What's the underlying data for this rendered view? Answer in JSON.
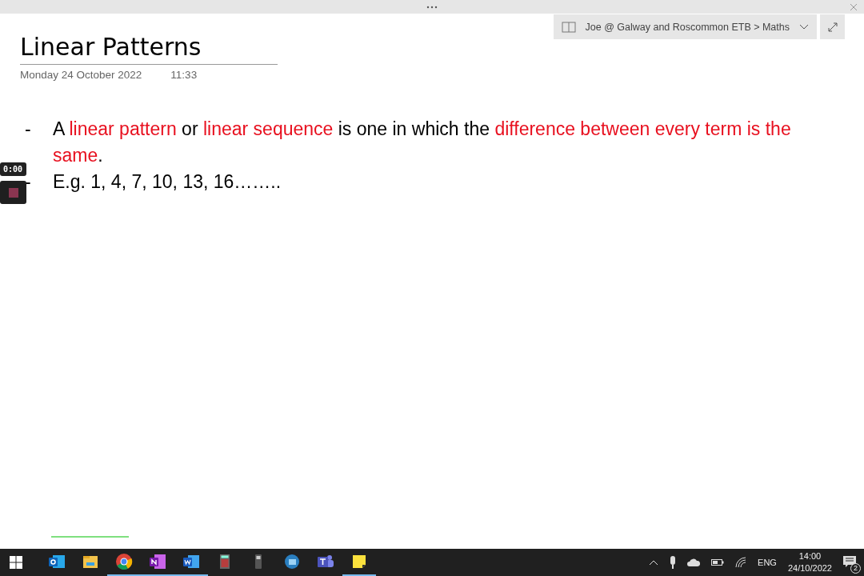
{
  "notebook_bar": {
    "path": "Joe @ Galway and Roscommon ETB > Maths"
  },
  "page": {
    "title": "Linear Patterns",
    "date": "Monday 24 October 2022",
    "time": "11:33",
    "bullets": [
      {
        "marker": "-",
        "segments": [
          {
            "text": "A ",
            "highlight": false
          },
          {
            "text": "linear pattern",
            "highlight": true
          },
          {
            "text": " or ",
            "highlight": false
          },
          {
            "text": "linear sequence",
            "highlight": true
          },
          {
            "text": " is one in which the ",
            "highlight": false
          },
          {
            "text": "difference between every term is the same",
            "highlight": true
          },
          {
            "text": ".",
            "highlight": false
          }
        ]
      },
      {
        "marker": "-",
        "segments": [
          {
            "text": "E.g. 1, 4, 7, 10, 13, 16……..",
            "highlight": false
          }
        ]
      }
    ]
  },
  "recorder": {
    "elapsed": "0:00"
  },
  "taskbar": {
    "apps": [
      {
        "kind": "outlook",
        "running": false
      },
      {
        "kind": "explorer",
        "running": false
      },
      {
        "kind": "chrome",
        "running": true
      },
      {
        "kind": "onenote",
        "running": true
      },
      {
        "kind": "word",
        "running": true
      },
      {
        "kind": "calculator",
        "running": false
      },
      {
        "kind": "device",
        "running": false
      },
      {
        "kind": "snipping",
        "running": false
      },
      {
        "kind": "teams",
        "running": false
      },
      {
        "kind": "sticky",
        "running": true
      }
    ],
    "language": "ENG",
    "time": "14:00",
    "date": "24/10/2022",
    "notifications": "2"
  }
}
